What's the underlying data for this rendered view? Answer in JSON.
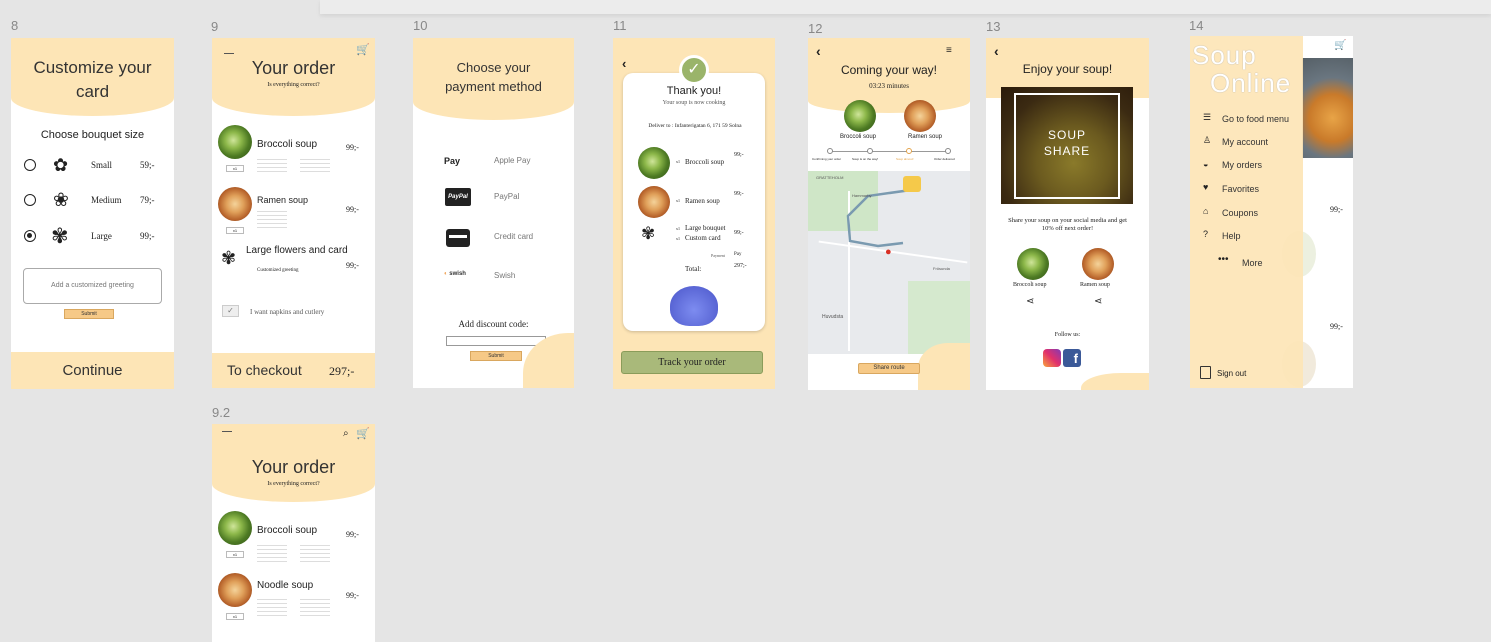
{
  "frame_labels": [
    "8",
    "9",
    "10",
    "11",
    "12",
    "13",
    "14",
    "9.2"
  ],
  "f8": {
    "title": "Customize your card",
    "subtitle": "Choose bouquet size",
    "options": [
      {
        "label": "Small",
        "price": "59;-"
      },
      {
        "label": "Medium",
        "price": "79;-"
      },
      {
        "label": "Large",
        "price": "99;-"
      }
    ],
    "greeting_placeholder": "Add a customized greeting",
    "submit": "Submit",
    "continue": "Continue"
  },
  "f9": {
    "title": "Your order",
    "subtitle": "Is everything correct?",
    "items": [
      {
        "name": "Broccoli soup",
        "price": "99;-",
        "qty": "x1"
      },
      {
        "name": "Ramen soup",
        "price": "99;-",
        "qty": "x1"
      }
    ],
    "card_item": "Large flowers and card",
    "card_price": "99;-",
    "card_note": "Customized greeting",
    "napkins": "I want napkins and cutlery",
    "checkout": "To checkout",
    "total": "297;-"
  },
  "f10": {
    "title": "Choose your payment method",
    "methods": [
      {
        "logo": "Pay",
        "label": "Apple Pay"
      },
      {
        "logo": "PayPal",
        "label": "PayPal"
      },
      {
        "logo": "card",
        "label": "Credit card"
      },
      {
        "logo": "swish",
        "label": "Swish"
      }
    ],
    "discount_label": "Add discount code:",
    "submit": "Submit"
  },
  "f11": {
    "title": "Thank you!",
    "subtitle": "Your soup is now cooking",
    "deliver": "Deliver to : Infanterigatan 6, 171 59 Solna",
    "items": [
      {
        "name": "Broccoli soup",
        "price": "99;-",
        "qty": "x1"
      },
      {
        "name": "Ramen soup",
        "price": "99;-",
        "qty": "x1"
      },
      {
        "name": "Large bouquet",
        "price": "99;-",
        "qty": "x1"
      },
      {
        "name": "Custom card",
        "price": "",
        "qty": "x1"
      }
    ],
    "payment_label": "Payment",
    "payment_value": "Pay",
    "total_label": "Total:",
    "total_value": "297;-",
    "track": "Track your order"
  },
  "f12": {
    "title": "Coming your way!",
    "timer": "03:23 minutes",
    "items": [
      {
        "name": "Broccoli soup",
        "qty": "x1"
      },
      {
        "name": "Ramen soup",
        "qty": "x1"
      }
    ],
    "steps": [
      "Confirming your order",
      "Soup is on the way!",
      "Soup almost!",
      "Order delivered"
    ],
    "map_labels": [
      "Hammarby",
      "Frösunda",
      "Huvudsta",
      "GRATTEHOLM"
    ],
    "share_route": "Share route"
  },
  "f13": {
    "title": "Enjoy your soup!",
    "image_text": "SOUP SHARE",
    "text": "Share your soup on your social media and get 10% off next order!",
    "items": [
      "Broccoli soup",
      "Ramen soup"
    ],
    "follow": "Follow us:"
  },
  "f14": {
    "logo_line1": "Soup",
    "logo_line2": "Online",
    "menu": [
      {
        "icon": "list-icon",
        "label": "Go to food menu"
      },
      {
        "icon": "user-icon",
        "label": "My account"
      },
      {
        "icon": "orders-icon",
        "label": "My orders"
      },
      {
        "icon": "heart-icon",
        "label": "Favorites"
      },
      {
        "icon": "gift-icon",
        "label": "Coupons"
      },
      {
        "icon": "help-icon",
        "label": "Help"
      },
      {
        "icon": "dots-icon",
        "label": "More"
      }
    ],
    "sign_out": "Sign out",
    "prices": [
      "99;-",
      "99;-"
    ]
  },
  "f92": {
    "title": "Your order",
    "subtitle": "Is everything correct?",
    "items": [
      {
        "name": "Broccoli soup",
        "price": "99;-",
        "qty": "x1"
      },
      {
        "name": "Noodle soup",
        "price": "99;-",
        "qty": "x1"
      }
    ]
  },
  "colors": {
    "cream": "#fde5b6",
    "accent": "#f6c987",
    "green_btn": "#a9b97a",
    "bg": "#e5e5e5"
  }
}
